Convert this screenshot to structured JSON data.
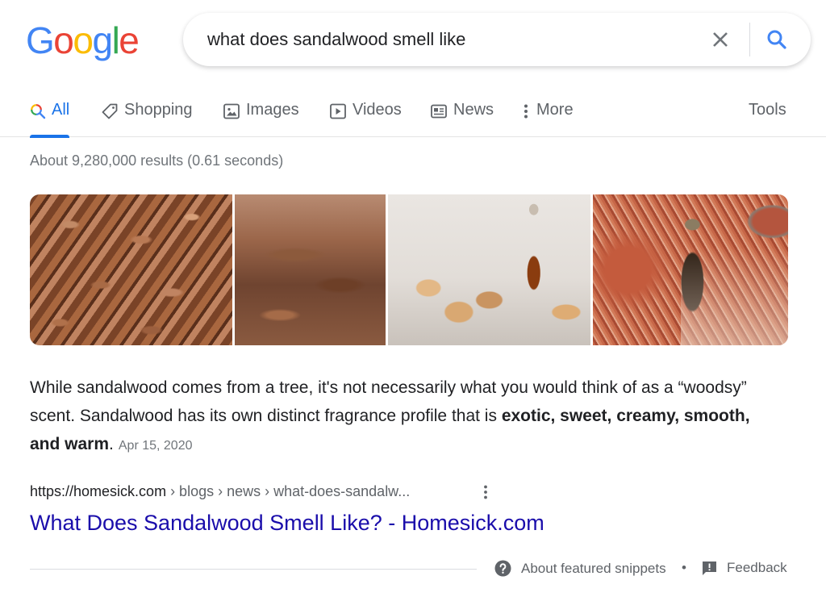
{
  "logo": {
    "letters": [
      "G",
      "o",
      "o",
      "g",
      "l",
      "e"
    ],
    "colors": [
      "#4285f4",
      "#ea4335",
      "#fbbc05",
      "#4285f4",
      "#34a853",
      "#ea4335"
    ]
  },
  "search": {
    "query": "what does sandalwood smell like",
    "clear_icon": "close-icon",
    "search_icon": "search-icon"
  },
  "tabs": [
    {
      "label": "All",
      "icon": "search-multicolor-icon",
      "active": true
    },
    {
      "label": "Shopping",
      "icon": "tag-icon",
      "active": false
    },
    {
      "label": "Images",
      "icon": "image-icon",
      "active": false
    },
    {
      "label": "Videos",
      "icon": "play-icon",
      "active": false
    },
    {
      "label": "News",
      "icon": "newspaper-icon",
      "active": false
    },
    {
      "label": "More",
      "icon": "more-vert-icon",
      "active": false
    }
  ],
  "tools_label": "Tools",
  "result_stats": "About 9,280,000 results (0.61 seconds)",
  "images": [
    {
      "alt": "sandalwood chips"
    },
    {
      "alt": "sandalwood pieces closeup"
    },
    {
      "alt": "sandalwood essential oil bottle with wood blocks"
    },
    {
      "alt": "red sandalwood shavings with oil bottle"
    }
  ],
  "snippet": {
    "text_plain": "While sandalwood comes from a tree, it's not necessarily what you would think of as a “woodsy” scent. Sandalwood has its own distinct fragrance profile that is ",
    "text_bold": "exotic, sweet, creamy, smooth, and warm",
    "text_end": ".",
    "date": "Apr 15, 2020"
  },
  "result": {
    "url_domain": "https://homesick.com",
    "url_path": " › blogs › news › what-does-sandalw...",
    "title": "What Does Sandalwood Smell Like? - Homesick.com"
  },
  "footer": {
    "about_label": "About featured snippets",
    "separator": "•",
    "feedback_label": "Feedback"
  },
  "colors": {
    "accent": "#1a73e8",
    "link": "#1a0dab",
    "secondary_text": "#5f6368",
    "muted_text": "#70757a"
  }
}
